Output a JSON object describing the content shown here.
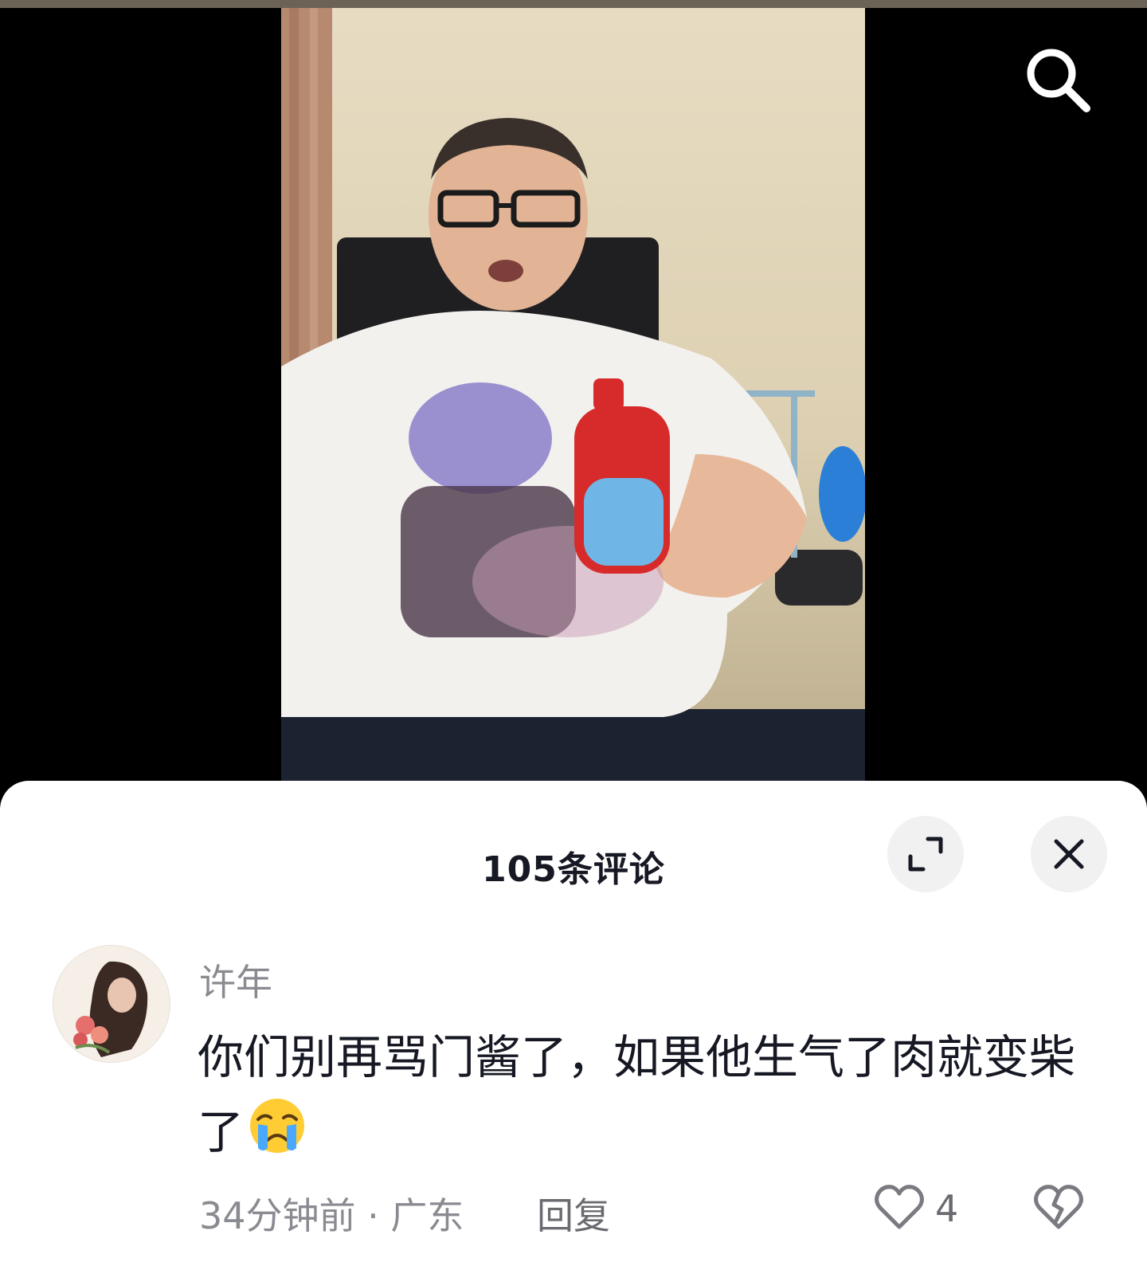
{
  "sheet": {
    "title": "105条评论",
    "expand_icon": "expand-icon",
    "close_icon": "close-icon"
  },
  "comment": {
    "username": "许年",
    "text": "你们别再骂门酱了，如果他生气了肉就变柴了",
    "emoji": "crying-face-emoji",
    "meta": "34分钟前 · 广东",
    "reply_label": "回复",
    "like_count": "4"
  },
  "icons": {
    "search": "search-icon",
    "like": "heart-outline-icon",
    "dislike": "broken-heart-icon"
  }
}
